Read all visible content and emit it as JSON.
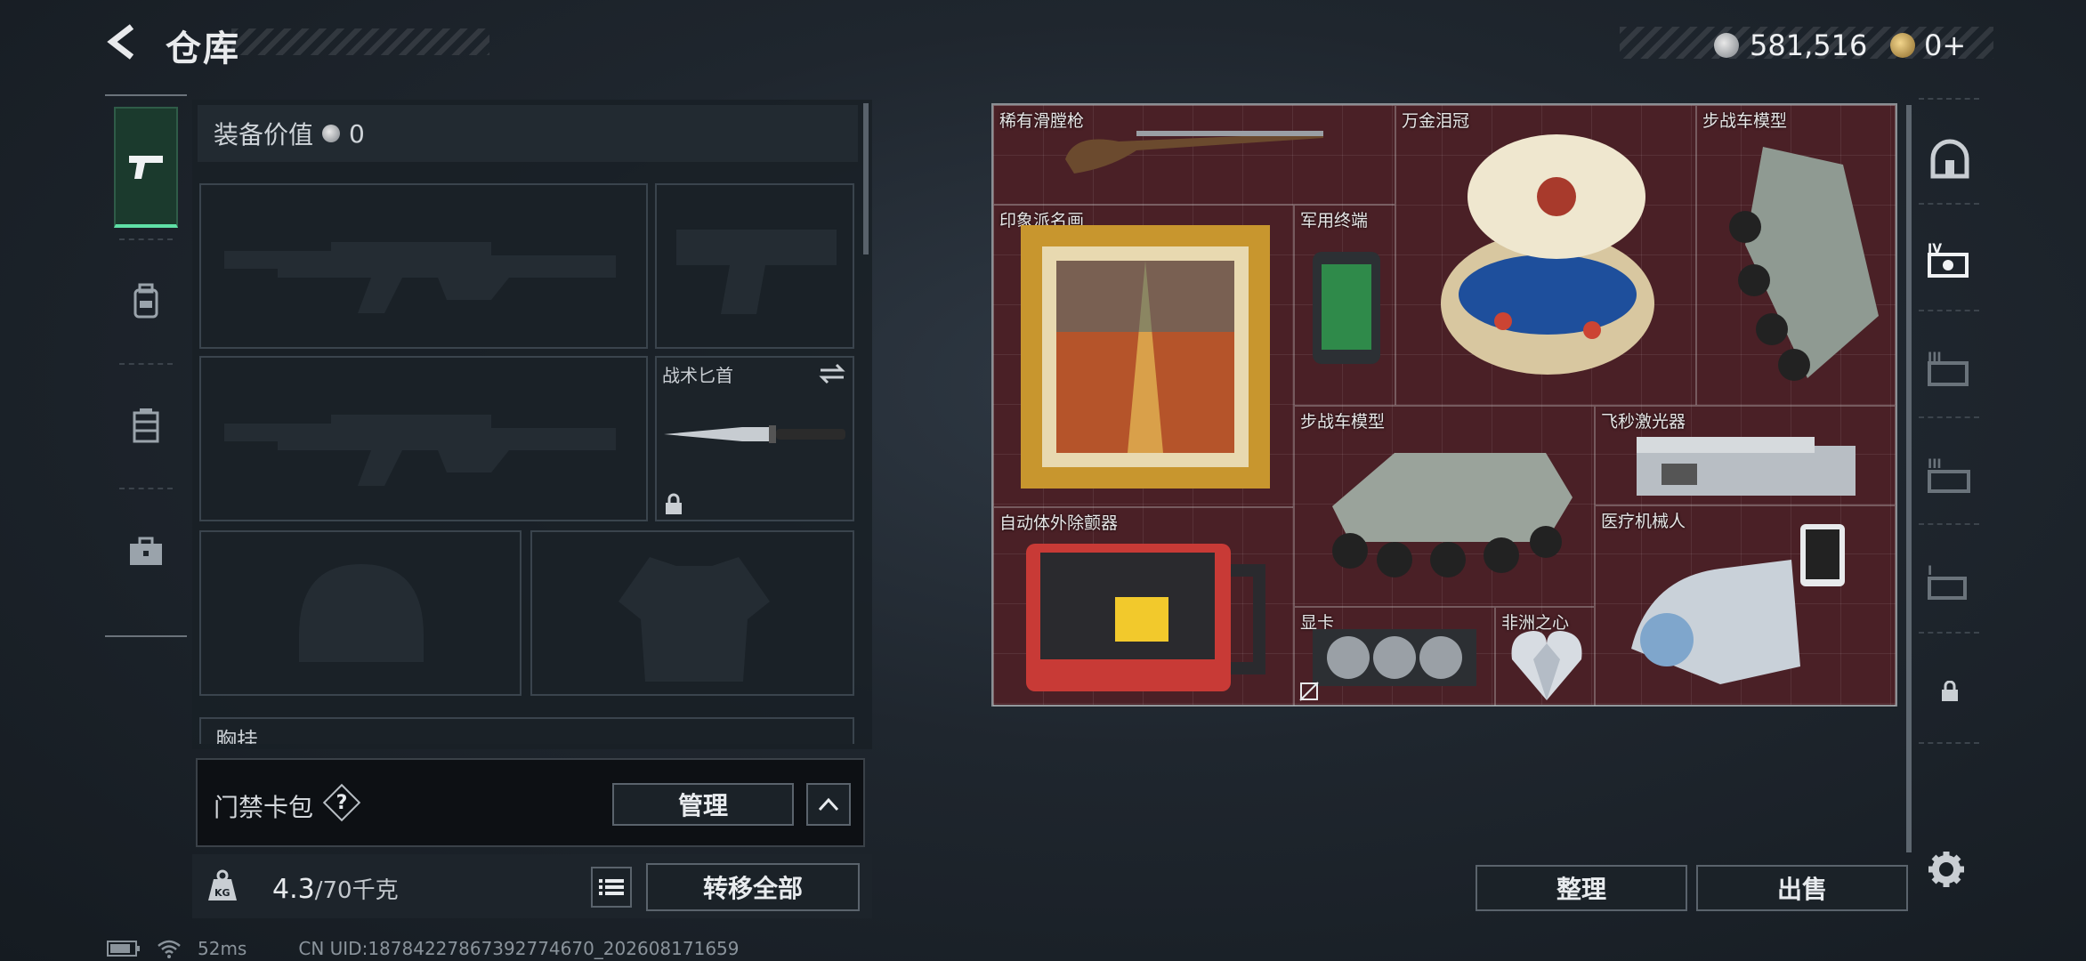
{
  "header": {
    "title": "仓库",
    "currency_silver": "581,516",
    "currency_gold": "0+"
  },
  "equipment": {
    "value_label": "装备价值",
    "value": "0",
    "knife_label": "战术匕首",
    "chest_label": "胸挂"
  },
  "keycard": {
    "label": "门禁卡包",
    "help": "?",
    "manage_label": "管理"
  },
  "capacity": {
    "current": "4.3",
    "max_label": "/70千克",
    "transfer_all_label": "转移全部"
  },
  "stash": {
    "items": [
      {
        "label": "稀有滑膛枪"
      },
      {
        "label": "万金泪冠"
      },
      {
        "label": "步战车模型"
      },
      {
        "label": "印象派名画"
      },
      {
        "label": "军用终端"
      },
      {
        "label": "步战车模型"
      },
      {
        "label": "飞秒激光器"
      },
      {
        "label": "自动体外除颤器"
      },
      {
        "label": "医疗机械人"
      },
      {
        "label": "显卡"
      },
      {
        "label": "非洲之心"
      }
    ],
    "sort_label": "整理",
    "sell_label": "出售"
  },
  "status_bar": {
    "latency": "52ms",
    "uid": "CN UID:18784227867392774670_202608171659"
  },
  "colors": {
    "stash_bg": "#4a2026",
    "accent_green": "#5fe0a6"
  }
}
